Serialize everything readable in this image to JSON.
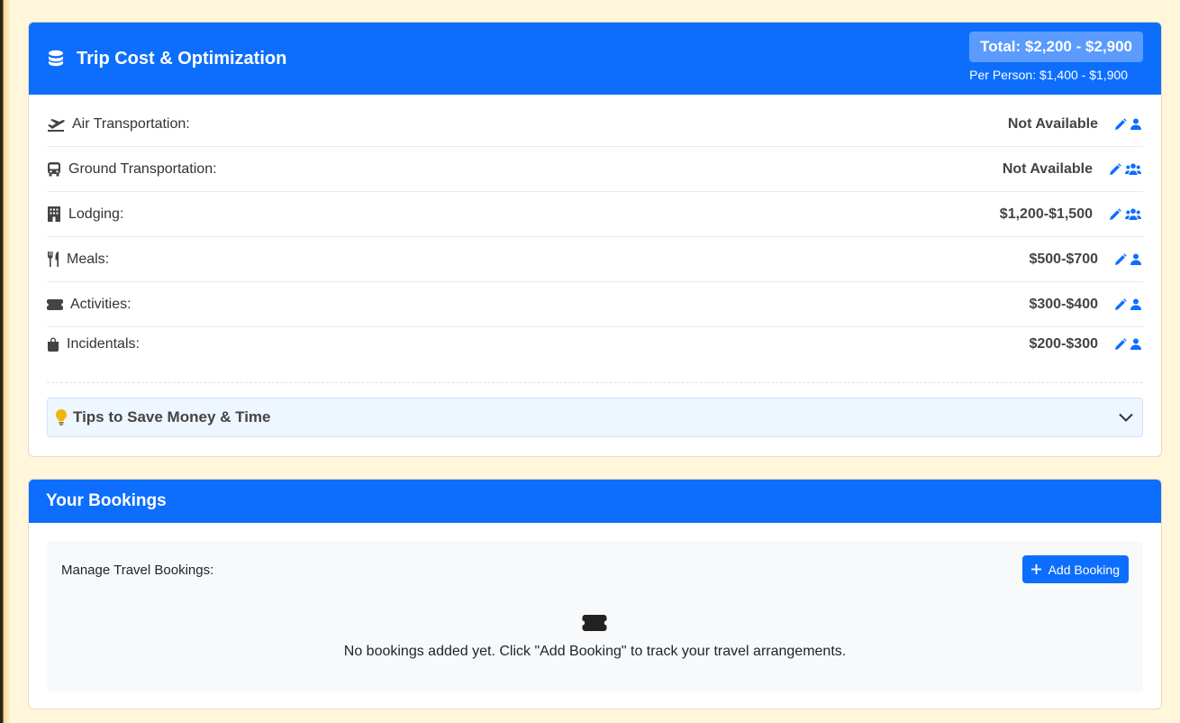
{
  "cost_card": {
    "title": "Trip Cost & Optimization",
    "total": "Total: $2,200 - $2,900",
    "per_person": "Per Person: $1,400 - $1,900",
    "items": [
      {
        "label": "Air Transportation:",
        "amount": "Not Available",
        "icon": "plane-departure-icon",
        "scope_icon": "user-icon"
      },
      {
        "label": "Ground Transportation:",
        "amount": "Not Available",
        "icon": "bus-icon",
        "scope_icon": "users-icon"
      },
      {
        "label": "Lodging:",
        "amount": "$1,200-$1,500",
        "icon": "building-icon",
        "scope_icon": "users-icon"
      },
      {
        "label": "Meals:",
        "amount": "$500-$700",
        "icon": "utensils-icon",
        "scope_icon": "user-icon"
      },
      {
        "label": "Activities:",
        "amount": "$300-$400",
        "icon": "ticket-icon",
        "scope_icon": "user-icon"
      },
      {
        "label": "Incidentals:",
        "amount": "$200-$300",
        "icon": "shopping-bag-icon",
        "scope_icon": "user-icon"
      }
    ],
    "tips_label": "Tips to Save Money & Time"
  },
  "bookings_card": {
    "title": "Your Bookings",
    "manage_label": "Manage Travel Bookings:",
    "add_button_label": "Add Booking",
    "empty_message": "No bookings added yet. Click \"Add Booking\" to track your travel arrangements."
  },
  "colors": {
    "primary": "#0d6efd",
    "background": "#fff6dc",
    "total_badge": "#5a9bfd",
    "tips_bg": "#eef6ff",
    "bulb": "#f2b705"
  }
}
